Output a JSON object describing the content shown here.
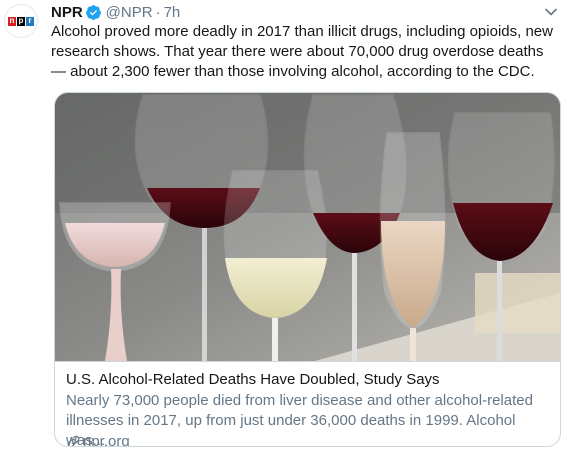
{
  "tweet": {
    "author_name": "NPR",
    "handle": "@NPR",
    "separator": "·",
    "time": "7h",
    "logo_letters": [
      "n",
      "p",
      "r"
    ],
    "text": "Alcohol proved more deadly in 2017 than illicit drugs, including opioids, new research shows. That year there were about 70,000 drug overdose deaths — about 2,300 fewer than those involving alcohol, according to the CDC."
  },
  "card": {
    "title": "U.S. Alcohol-Related Deaths Have Doubled, Study Says",
    "description": "Nearly 73,000 people died from liver disease and other alcohol-related illnesses in 2017, up from just under 36,000 deaths in 1999. Alcohol was...",
    "domain": "npr.org"
  },
  "icons": {
    "verified": "verified-badge-icon",
    "menu": "chevron-down-icon",
    "link": "link-icon"
  },
  "colors": {
    "npr_red": "#d62021",
    "npr_black": "#000000",
    "npr_blue": "#237bbd",
    "verified_blue": "#1da1f2",
    "secondary_text": "#657786",
    "border": "#ccd6dd"
  }
}
